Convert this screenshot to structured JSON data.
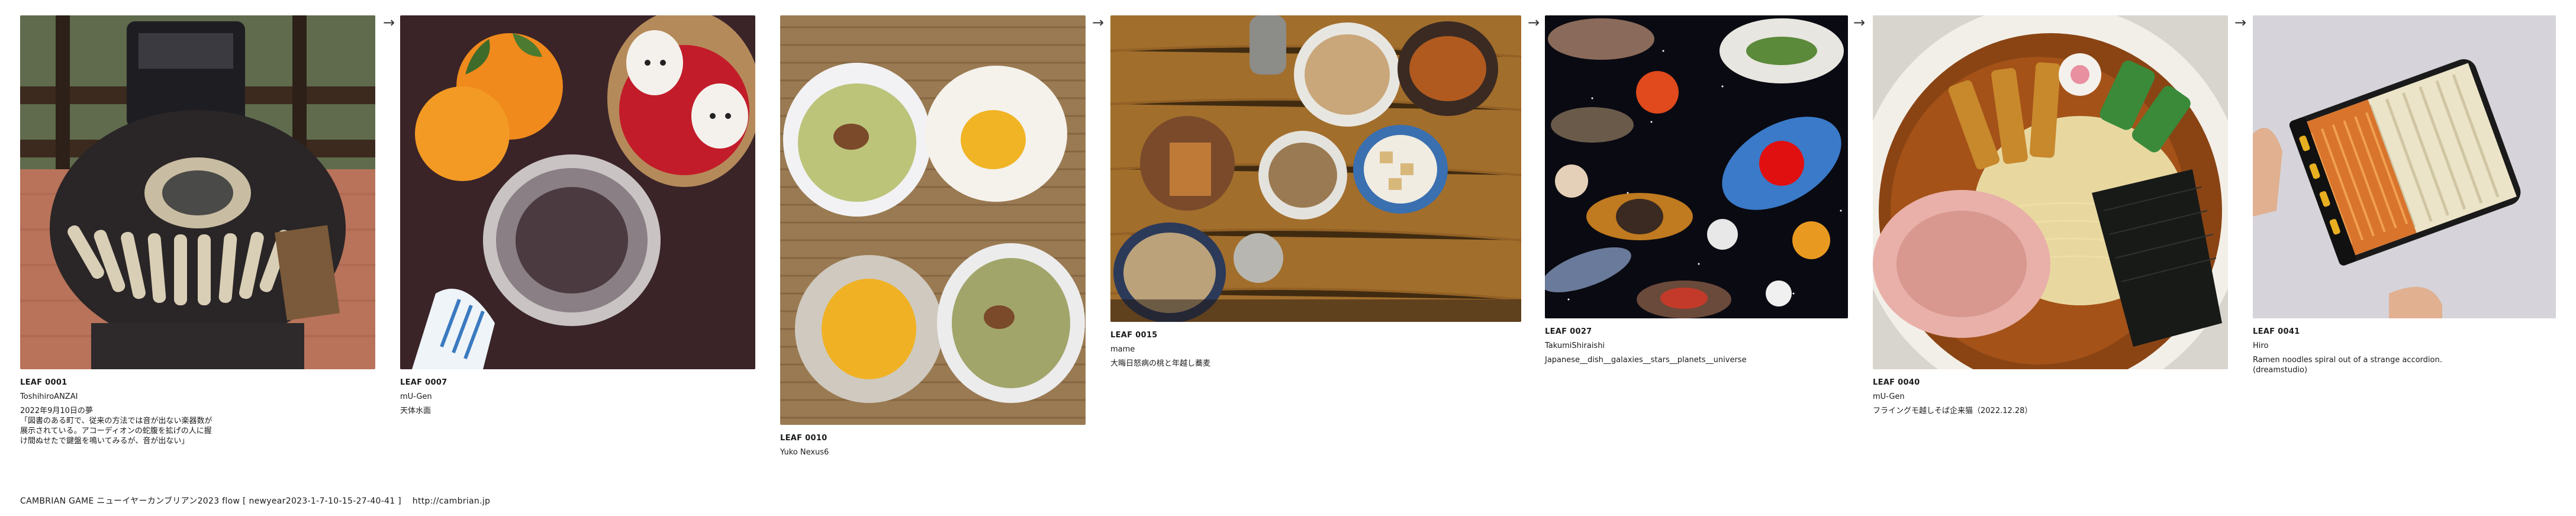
{
  "arrow_glyph": "→",
  "leaves": [
    {
      "id": "LEAF 0001",
      "author": "ToshihiroANZAI",
      "title": "2022年9月10日の夢\n「図書のある町で、従来の方法では音が出ない楽器数が\n展示されている。アコーディオンの蛇腹を拡げの人に握\nけ間ぬせたで鍵盤を鳴いてみるが、音が出ない」",
      "image": "accordion-object-on-brick-patio"
    },
    {
      "id": "LEAF 0007",
      "author": "mU-Gen",
      "title": "天体水面",
      "image": "oranges-glass-bowl-figurines"
    },
    {
      "id": "LEAF 0010",
      "author": "Yuko Nexus6",
      "title": "",
      "image": "tea-cups-and-sweets-on-mat"
    },
    {
      "id": "LEAF 0015",
      "author": "mame",
      "title": "大晦日怒病の桃と年越し蕎麦",
      "image": "japanese-dishes-on-wooden-table"
    },
    {
      "id": "LEAF 0027",
      "author": "TakumiShiraishi",
      "title": "Japanese__dish__galaxies__stars__planets__universe",
      "image": "space-collage-with-dishes"
    },
    {
      "id": "LEAF 0040",
      "author": "mU-Gen",
      "title": "フライングモ越しそば企来猫（2022.12.28）",
      "image": "ramen-bowl"
    },
    {
      "id": "LEAF 0041",
      "author": "Hiro",
      "title": "Ramen noodles spiral out of a strange accordion.\n(dreamstudio)",
      "image": "hand-holding-accordion"
    }
  ],
  "footer": {
    "game": "CAMBRIAN GAME ニューイヤーカンブリアン2023  flow [ newyear2023-1-7-10-15-27-40-41 ]",
    "url": "http://cambrian.jp"
  }
}
